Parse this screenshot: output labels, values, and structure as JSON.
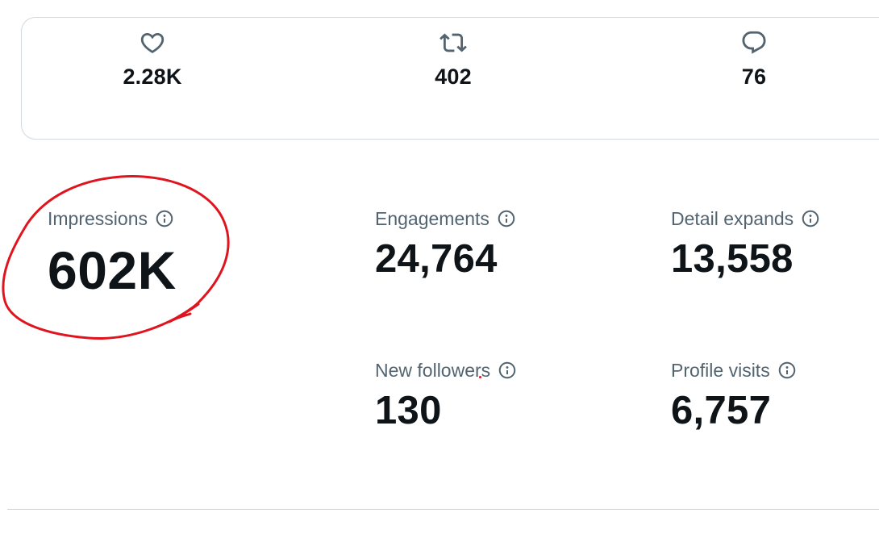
{
  "engagement_card": {
    "likes": {
      "value": "2.28K",
      "icon": "heart-icon"
    },
    "reposts": {
      "value": "402",
      "icon": "repost-icon"
    },
    "replies": {
      "value": "76",
      "icon": "reply-icon"
    }
  },
  "metrics": {
    "impressions": {
      "label": "Impressions",
      "value": "602K",
      "icon": "info-icon"
    },
    "engagements": {
      "label": "Engagements",
      "value": "24,764",
      "icon": "info-icon"
    },
    "detail_expands": {
      "label": "Detail expands",
      "value": "13,558",
      "icon": "info-icon"
    },
    "new_followers": {
      "label": "New followers",
      "value": "130",
      "icon": "info-icon"
    },
    "profile_visits": {
      "label": "Profile visits",
      "value": "6,757",
      "icon": "info-icon"
    }
  },
  "colors": {
    "text_primary": "#0f1419",
    "text_secondary": "#536471",
    "border": "#cfd9de",
    "annotation_red": "#e0141e"
  }
}
